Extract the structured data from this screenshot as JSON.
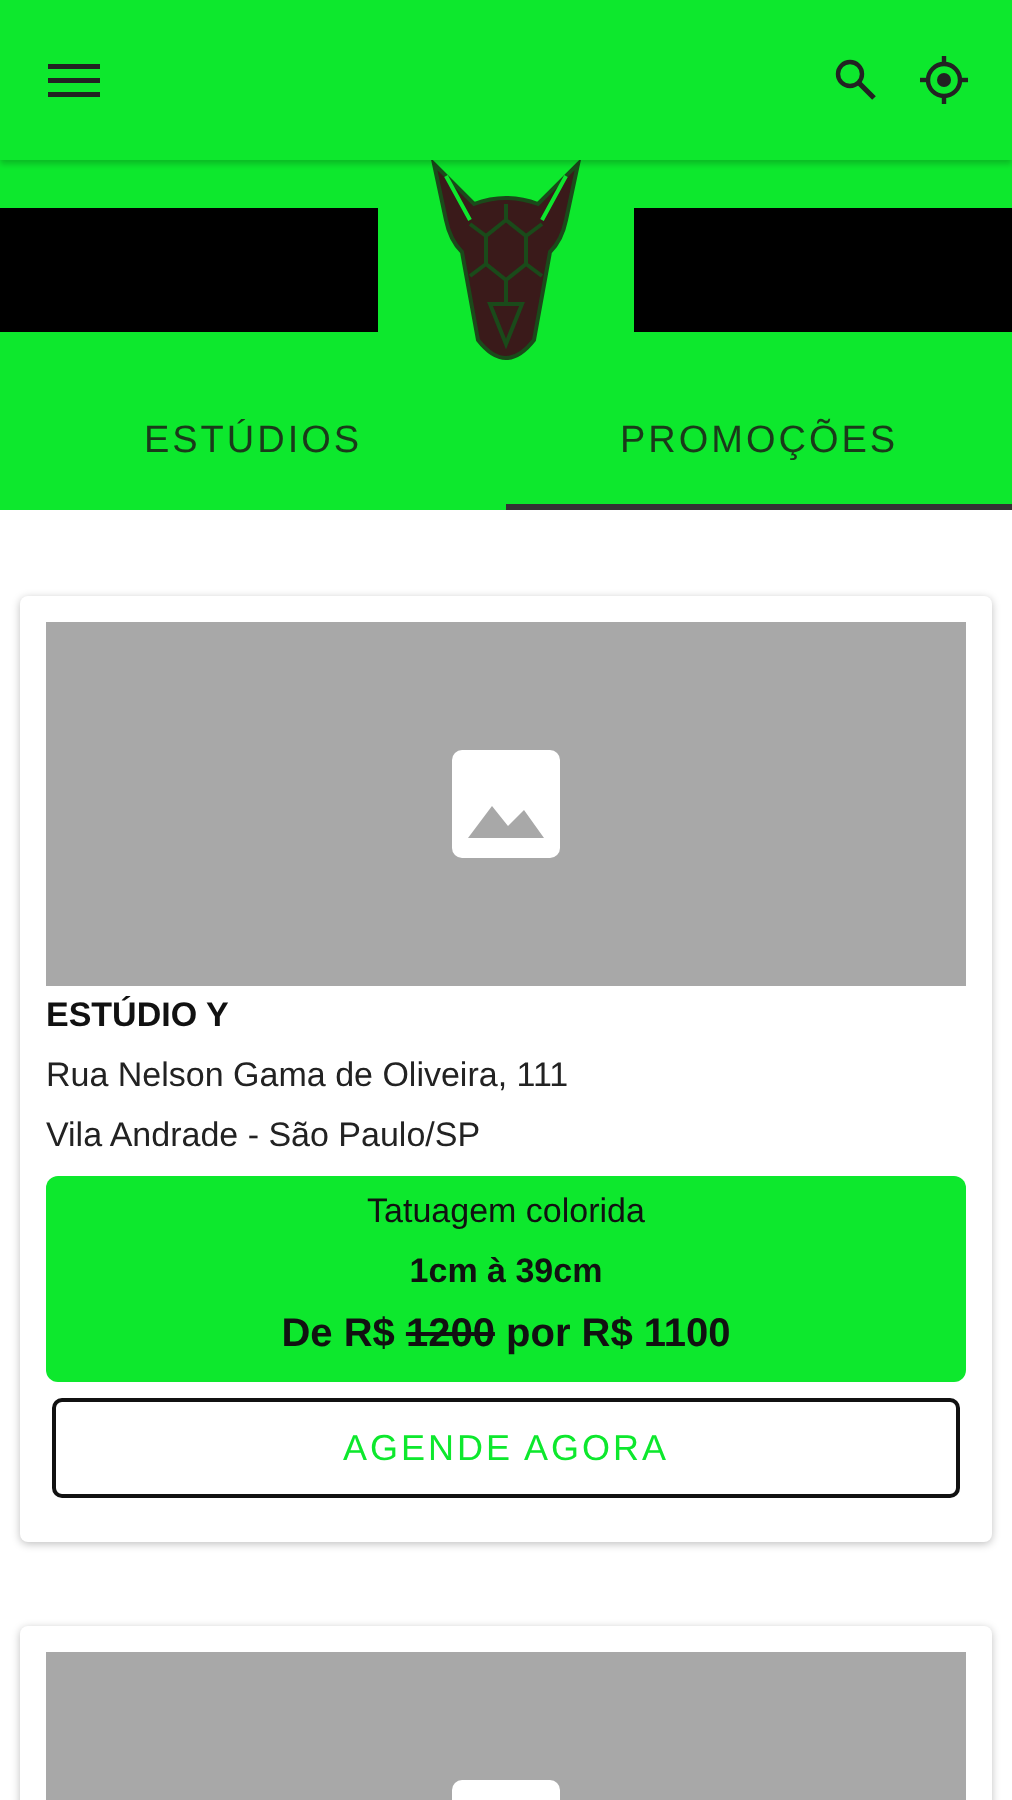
{
  "tabs": [
    {
      "label": "ESTÚDIOS",
      "selected": false
    },
    {
      "label": "PROMOÇÕES",
      "selected": true
    }
  ],
  "cards": [
    {
      "kind": "promo",
      "studio": "ESTÚDIO Y",
      "address_line_1": "Rua Nelson Gama de Oliveira, 111",
      "address_line_2": "Vila Andrade - São Paulo/SP",
      "service": "Tatuagem colorida",
      "size_range": "1cm à 39cm",
      "price_prefix": "De R$",
      "old_price": "1200",
      "price_suffix": "por R$ 1100",
      "action": "AGENDE AGORA"
    },
    {
      "kind": "image_only"
    }
  ]
}
